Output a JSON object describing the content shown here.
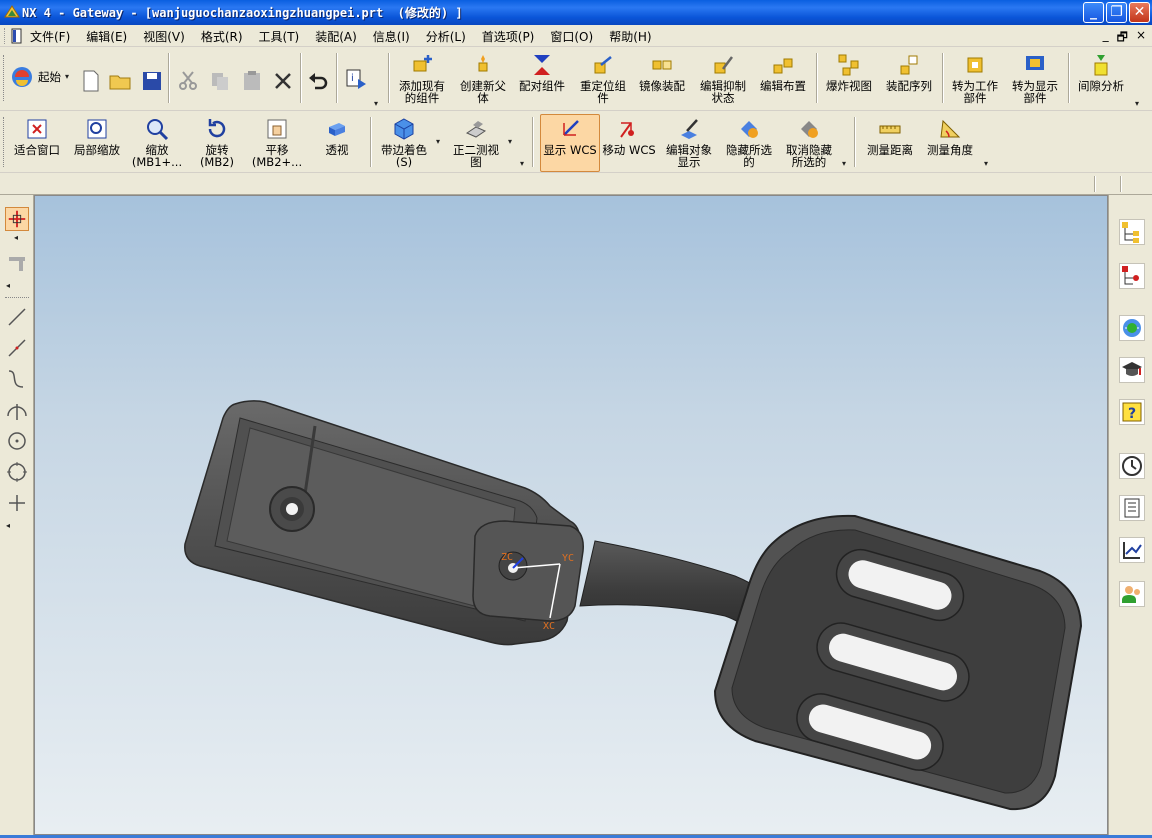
{
  "window": {
    "title": "NX 4 - Gateway - [wanjuguochanzaoxingzhuangpei.prt  (修改的) ]"
  },
  "menu": {
    "items": [
      "文件(F)",
      "编辑(E)",
      "视图(V)",
      "格式(R)",
      "工具(T)",
      "装配(A)",
      "信息(I)",
      "分析(L)",
      "首选项(P)",
      "窗口(O)",
      "帮助(H)"
    ],
    "mdi_controls": [
      "_",
      "🗗",
      "×"
    ]
  },
  "toolbar1": {
    "start_label": "起始",
    "assembly_buttons": [
      "添加现有\n的组件",
      "创建新父\n体",
      "配对组件",
      "重定位组\n件",
      "镜像装配",
      "编辑抑制\n状态",
      "编辑布置",
      "爆炸视图",
      "装配序列",
      "转为工作\n部件",
      "转为显示\n部件",
      "间隙分析"
    ]
  },
  "toolbar2": {
    "view_buttons": [
      "适合窗口",
      "局部缩放",
      "缩放\n(MB1+...",
      "旋转\n(MB2)",
      "平移\n(MB2+...",
      "透视"
    ],
    "shade_buttons": [
      "带边着色\n(S)",
      "正二测视\n图"
    ],
    "wcs_buttons": [
      "显示 WCS",
      "移动 WCS",
      "编辑对象\n显示",
      "隐藏所选\n的",
      "取消隐藏\n所选的"
    ],
    "measure_buttons": [
      "测量距离",
      "测量角度"
    ]
  },
  "viewport": {
    "wcs_axes": {
      "z": "ZC",
      "y": "YC",
      "x": "XC"
    }
  },
  "colors": {
    "accent": "#0a5fe0",
    "active_button": "#fcd7a4",
    "axis_label": "#e07020",
    "model": "#4a4a4a"
  }
}
